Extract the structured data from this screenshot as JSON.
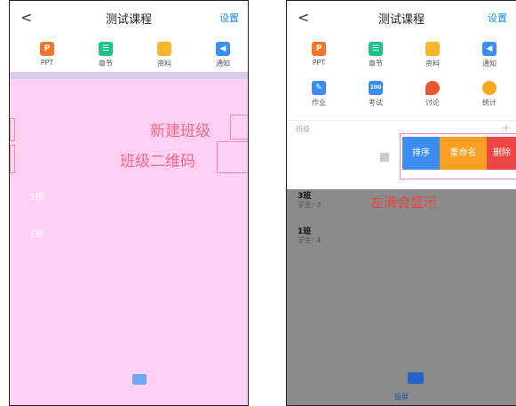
{
  "left": {
    "header": {
      "back": "<",
      "title": "测试课程",
      "settings": "设置"
    },
    "grid": [
      {
        "icon": "ppt-icon",
        "glyph": "P",
        "label": "PPT"
      },
      {
        "icon": "chapter-icon",
        "glyph": "☰",
        "label": "章节"
      },
      {
        "icon": "folder-icon",
        "glyph": "",
        "label": "资料"
      },
      {
        "icon": "notice-icon",
        "glyph": "◀",
        "label": "通知"
      }
    ],
    "annotations": {
      "new_class": "新建班级",
      "class_qr": "班级二维码"
    },
    "classes": [
      "3班",
      "1班"
    ]
  },
  "right": {
    "header": {
      "back": "<",
      "title": "测试课程",
      "settings": "设置"
    },
    "grid": [
      {
        "icon": "ppt-icon",
        "glyph": "P",
        "label": "PPT"
      },
      {
        "icon": "chapter-icon",
        "glyph": "☰",
        "label": "章节"
      },
      {
        "icon": "folder-icon",
        "glyph": "",
        "label": "资料"
      },
      {
        "icon": "notice-icon",
        "glyph": "◀",
        "label": "通知"
      },
      {
        "icon": "homework-icon",
        "glyph": "✎",
        "label": "作业"
      },
      {
        "icon": "exam-icon",
        "glyph": "100",
        "label": "考试"
      },
      {
        "icon": "discussion-icon",
        "glyph": "",
        "label": "讨论"
      },
      {
        "icon": "stats-icon",
        "glyph": "",
        "label": "统计"
      }
    ],
    "section_label": "班级",
    "section_add": "+",
    "swipe_actions": {
      "sort": "排序",
      "rename": "重命名",
      "delete": "删除"
    },
    "swipe_hint": "左滑会显示",
    "classes": [
      {
        "name": "3班",
        "students": "学生: 3"
      },
      {
        "name": "1班",
        "students": "学生: 4"
      }
    ],
    "bottom_label": "投屏"
  }
}
